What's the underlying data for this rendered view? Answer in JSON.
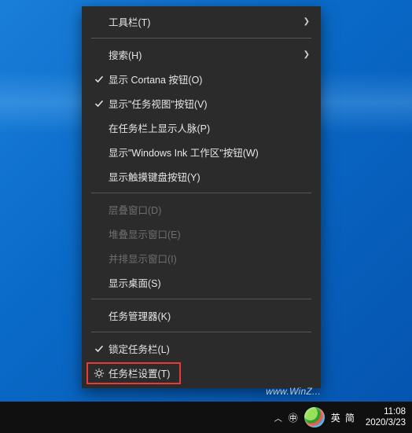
{
  "menu": {
    "toolbars": "工具栏(T)",
    "search": "搜索(H)",
    "show_cortana": "显示 Cortana 按钮(O)",
    "show_taskview": "显示\"任务视图\"按钮(V)",
    "show_people": "在任务栏上显示人脉(P)",
    "show_wink": "显示\"Windows Ink 工作区\"按钮(W)",
    "show_touchkb": "显示触摸键盘按钮(Y)",
    "cascade": "层叠窗口(D)",
    "stacked": "堆叠显示窗口(E)",
    "sidebyside": "并排显示窗口(I)",
    "show_desktop": "显示桌面(S)",
    "task_manager": "任务管理器(K)",
    "lock_taskbar": "锁定任务栏(L)",
    "taskbar_settings": "任务栏设置(T)"
  },
  "taskbar": {
    "ime_mode": "英",
    "ime_full": "简",
    "time": "11:08",
    "date": "2020/3/23"
  },
  "watermark": "www.WinZ..."
}
